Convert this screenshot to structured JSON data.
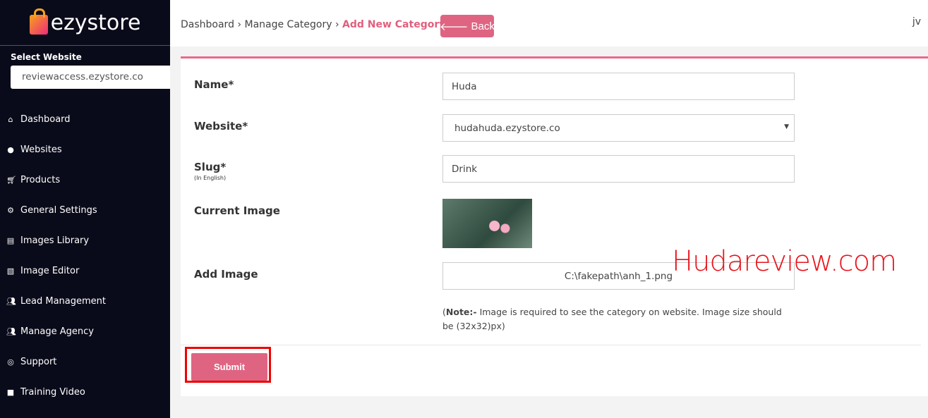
{
  "brand": {
    "name": "ezystore"
  },
  "sidebar": {
    "select_label": "Select Website",
    "select_value": "reviewaccess.ezystore.co",
    "items": [
      {
        "label": "Dashboard",
        "icon": "home-icon"
      },
      {
        "label": "Websites",
        "icon": "globe-icon"
      },
      {
        "label": "Products",
        "icon": "cart-icon"
      },
      {
        "label": "General Settings",
        "icon": "gears-icon"
      },
      {
        "label": "Images Library",
        "icon": "file-image-icon"
      },
      {
        "label": "Image Editor",
        "icon": "image-icon"
      },
      {
        "label": "Lead Management",
        "icon": "users-icon"
      },
      {
        "label": "Manage Agency",
        "icon": "users-icon"
      },
      {
        "label": "Support",
        "icon": "lifebuoy-icon"
      },
      {
        "label": "Training Video",
        "icon": "video-icon"
      }
    ]
  },
  "header": {
    "crumbs": [
      "Dashboard",
      "Manage Category",
      "Add New Category"
    ],
    "sep": "›",
    "back_label": "Back",
    "user": "jv"
  },
  "form": {
    "name_label": "Name*",
    "name_value": "Huda",
    "website_label": "Website*",
    "website_value": "hudahuda.ezystore.co",
    "slug_label": "Slug*",
    "slug_sub": "(In English)",
    "slug_value": "Drink",
    "current_image_label": "Current Image",
    "add_image_label": "Add Image",
    "add_image_value": "C:\\fakepath\\anh_1.png",
    "note_bold": "Note:-",
    "note_text": " Image is required to see the category on website. Image size should be (32x32)px)",
    "submit_label": "Submit"
  },
  "watermark": "Hudareview.com"
}
